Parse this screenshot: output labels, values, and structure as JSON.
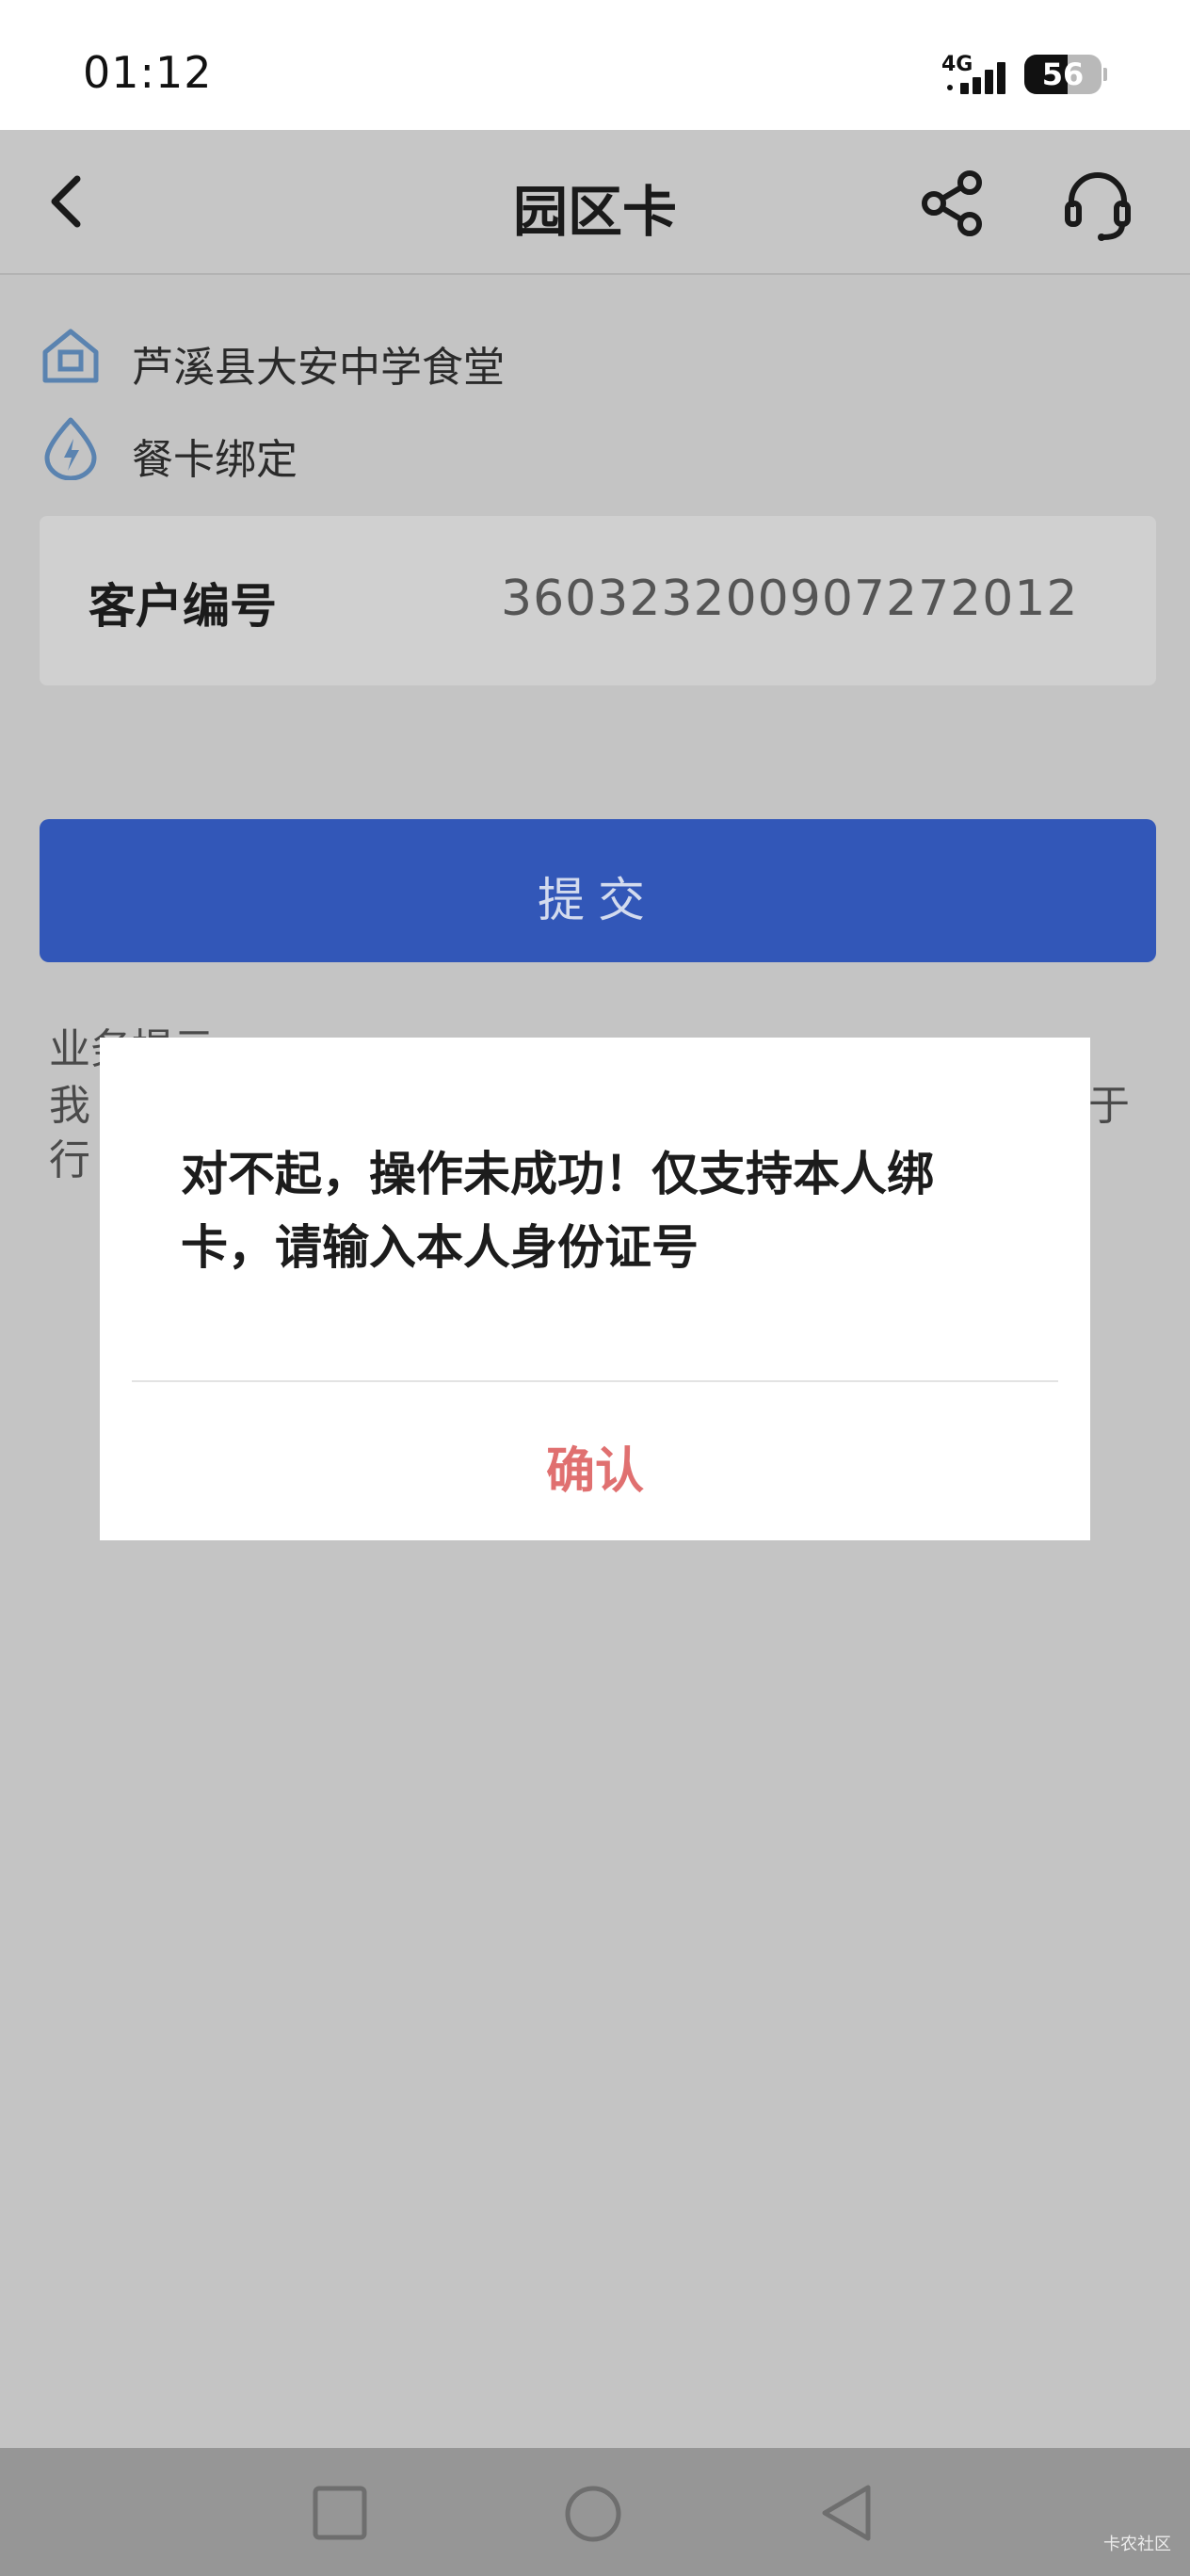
{
  "status_bar": {
    "time": "01:12",
    "network": "4G",
    "signal_level": 4,
    "battery_percent": 56,
    "battery_text": "56"
  },
  "header": {
    "title": "园区卡",
    "back_icon": "chevron-left-icon",
    "share_icon": "share-icon",
    "support_icon": "headset-icon"
  },
  "info": {
    "location": "芦溪县大安中学食堂",
    "location_icon": "home-icon",
    "service": "餐卡绑定",
    "service_icon": "bolt-drop-icon"
  },
  "customer": {
    "label": "客户编号",
    "value": "360323200907272012"
  },
  "submit": {
    "label": "提交"
  },
  "notice": {
    "title_visible": "业务提示",
    "line1_left": "我",
    "line1_right": "于",
    "line2_left": "行"
  },
  "dialog": {
    "message": "对不起，操作未成功！仅支持本人绑卡，请输入本人身份证号",
    "confirm_label": "确认"
  },
  "nav_bar": {
    "icons": [
      "square-icon",
      "circle-icon",
      "triangle-back-icon"
    ]
  },
  "watermark": "卡农社区",
  "colors": {
    "accent": "#3257b8",
    "icon_blue": "#5a83b0",
    "confirm": "#e07070",
    "overlay_gray": "#c4c4c4"
  }
}
